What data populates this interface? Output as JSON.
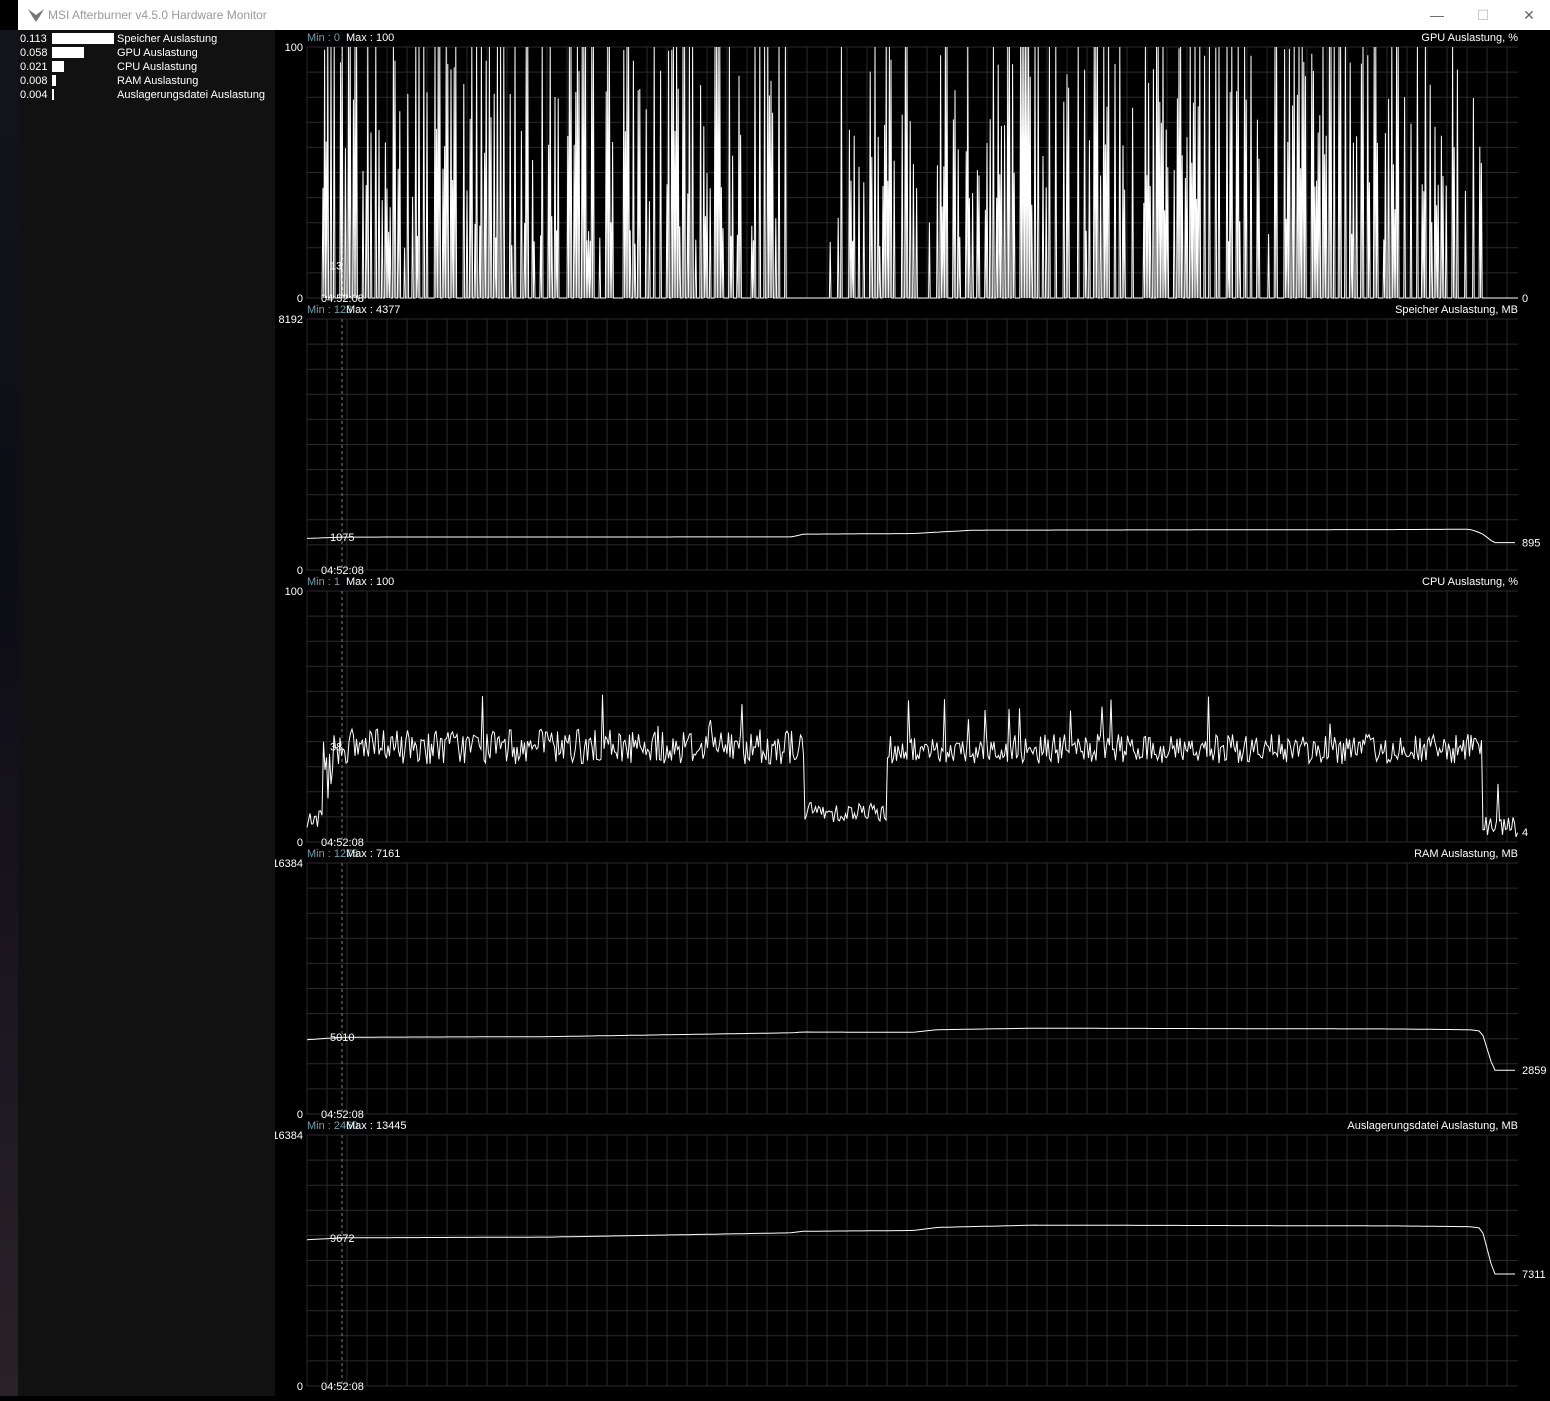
{
  "window": {
    "title": "MSI Afterburner v4.5.0 Hardware Monitor",
    "controls": {
      "minimize": "—",
      "maximize": "☐",
      "close": "✕"
    }
  },
  "legend": [
    {
      "value": "0.113",
      "label": "Speicher Auslastung",
      "fraction": 0.113
    },
    {
      "value": "0.058",
      "label": "GPU Auslastung",
      "fraction": 0.058
    },
    {
      "value": "0.021",
      "label": "CPU Auslastung",
      "fraction": 0.021
    },
    {
      "value": "0.008",
      "label": "RAM Auslastung",
      "fraction": 0.008
    },
    {
      "value": "0.004",
      "label": "Auslagerungsdatei Auslastung",
      "fraction": 0.004
    }
  ],
  "graphs": [
    {
      "name": "GPU Auslastung, %",
      "min_label": "Min : 0",
      "max_label": "Max : 100",
      "ymax_label": "100",
      "ymin_label": "0",
      "ymax": 100,
      "time": "04:52:08",
      "cursor_value": "13",
      "current_value": "0",
      "cursor_v": 13,
      "current_v": 0,
      "kind": "spiky"
    },
    {
      "name": "Speicher Auslastung, MB",
      "min_label": "Min : 123",
      "max_label": "Max : 4377",
      "ymax_label": "8192",
      "ymin_label": "0",
      "ymax": 8192,
      "time": "04:52:08",
      "cursor_value": "1075",
      "current_value": "895",
      "cursor_v": 1075,
      "current_v": 895,
      "kind": "flat",
      "profile": [
        [
          0,
          1030
        ],
        [
          0.03,
          1075
        ],
        [
          0.4,
          1080
        ],
        [
          0.41,
          1170
        ],
        [
          0.5,
          1190
        ],
        [
          0.55,
          1300
        ],
        [
          0.9,
          1320
        ],
        [
          0.96,
          1330
        ],
        [
          0.97,
          1200
        ],
        [
          0.98,
          895
        ],
        [
          1,
          895
        ]
      ]
    },
    {
      "name": "CPU Auslastung, %",
      "min_label": "Min : 1",
      "max_label": "Max : 100",
      "ymax_label": "100",
      "ymin_label": "0",
      "ymax": 100,
      "time": "04:52:08",
      "cursor_value": "38",
      "current_value": "4",
      "cursor_v": 38,
      "current_v": 4,
      "kind": "noisy"
    },
    {
      "name": "RAM Auslastung, MB",
      "min_label": "Min : 1275",
      "max_label": "Max : 7161",
      "ymax_label": "16384",
      "ymin_label": "0",
      "ymax": 16384,
      "time": "04:52:08",
      "cursor_value": "5010",
      "current_value": "2859",
      "cursor_v": 5010,
      "current_v": 2859,
      "kind": "flat",
      "profile": [
        [
          0,
          4850
        ],
        [
          0.03,
          5010
        ],
        [
          0.2,
          5050
        ],
        [
          0.4,
          5300
        ],
        [
          0.41,
          5350
        ],
        [
          0.5,
          5330
        ],
        [
          0.52,
          5500
        ],
        [
          0.6,
          5600
        ],
        [
          0.9,
          5550
        ],
        [
          0.96,
          5500
        ],
        [
          0.97,
          5400
        ],
        [
          0.98,
          2859
        ],
        [
          1,
          2859
        ]
      ]
    },
    {
      "name": "Auslagerungsdatei Auslastung, MB",
      "min_label": "Min : 2460",
      "max_label": "Max : 13445",
      "ymax_label": "16384",
      "ymin_label": "0",
      "ymax": 16384,
      "time": "04:52:08",
      "cursor_value": "9672",
      "current_value": "7311",
      "cursor_v": 9672,
      "current_v": 7311,
      "kind": "flat",
      "profile": [
        [
          0,
          9550
        ],
        [
          0.03,
          9672
        ],
        [
          0.2,
          9720
        ],
        [
          0.4,
          10000
        ],
        [
          0.41,
          10100
        ],
        [
          0.5,
          10150
        ],
        [
          0.52,
          10350
        ],
        [
          0.6,
          10500
        ],
        [
          0.9,
          10450
        ],
        [
          0.96,
          10400
        ],
        [
          0.97,
          10300
        ],
        [
          0.98,
          7311
        ],
        [
          1,
          7311
        ]
      ]
    }
  ],
  "colors": {
    "line": "#ffffff",
    "grid": "#2a2a2a",
    "min_text": "#6fa0a8",
    "cursor": "#8a8a2a"
  }
}
